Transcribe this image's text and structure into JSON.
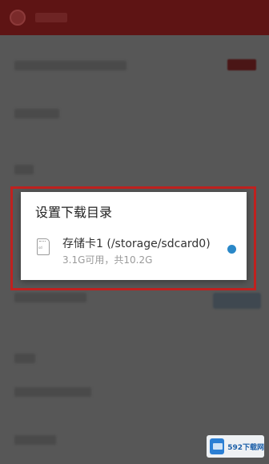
{
  "dialog": {
    "title": "设置下载目录",
    "options": [
      {
        "label": "存储卡1 (/storage/sdcard0)",
        "detail": "3.1G可用，共10.2G",
        "selected": true,
        "icon": "sd-card-icon"
      }
    ]
  },
  "colors": {
    "accent": "#2a88c8",
    "highlight": "#c0211f",
    "appbar": "#5e1414"
  },
  "watermark": {
    "text": "592下载网"
  }
}
